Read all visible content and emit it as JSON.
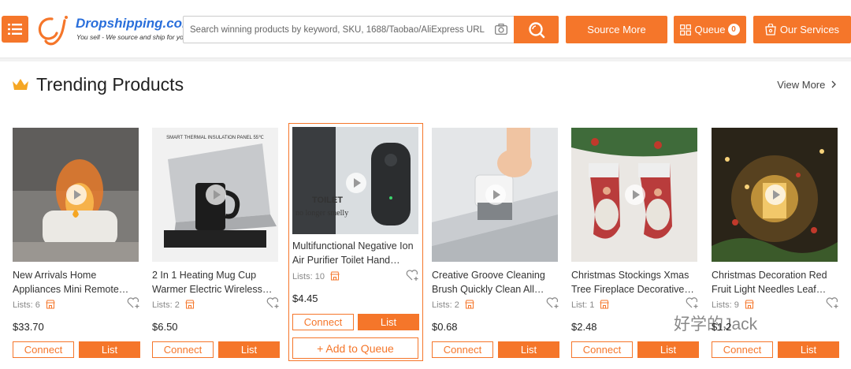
{
  "header": {
    "logo_text": "Dropshipping.com",
    "logo_tagline": "You sell - We source and ship for you!",
    "search_placeholder": "Search winning products by keyword, SKU, 1688/Taobao/AliExpress URL",
    "search_value": "",
    "source_more_label": "Source More",
    "queue_label": "Queue",
    "queue_count": "0",
    "our_services_label": "Our Services"
  },
  "section": {
    "title": "Trending Products",
    "view_more_label": "View More"
  },
  "buttons": {
    "connect_label": "Connect",
    "list_label": "List",
    "add_to_queue_label": "+ Add to Queue"
  },
  "products": [
    {
      "title_line1": "New Arrivals Home",
      "title_line2": "Appliances Mini Remote…",
      "lists": "Lists: 6",
      "price": "$33.70"
    },
    {
      "title_line1": "2 In 1 Heating Mug Cup",
      "title_line2": "Warmer Electric Wireless…",
      "lists": "Lists: 2",
      "price": "$6.50",
      "image_text": "SMART THERMAL INSULATION PANEL 55℃"
    },
    {
      "title_line1": "Multifunctional Negative Ion",
      "title_line2": "Air Purifier Toilet Hand…",
      "lists": "Lists: 10",
      "price": "$4.45",
      "image_text1": "TOILET",
      "image_text2": "no longer smelly"
    },
    {
      "title_line1": "Creative Groove Cleaning",
      "title_line2": "Brush Quickly Clean All…",
      "lists": "Lists: 2",
      "price": "$0.68"
    },
    {
      "title_line1": "Christmas Stockings Xmas",
      "title_line2": "Tree Fireplace Decorative…",
      "lists": "List: 1",
      "price": "$2.48"
    },
    {
      "title_line1": "Christmas Decoration Red",
      "title_line2": "Fruit Light Needles Leaf…",
      "lists": "Lists: 9",
      "price": "$1.2"
    }
  ],
  "watermark": "好学的Jack",
  "colors": {
    "accent": "#f5762a",
    "logo_blue": "#2a6fdb"
  },
  "icons": [
    "menu-icon",
    "camera-icon",
    "search-icon",
    "queue-icon",
    "services-icon",
    "crown-icon",
    "chevron-right-icon",
    "play-icon",
    "store-icon",
    "heart-plus-icon"
  ]
}
